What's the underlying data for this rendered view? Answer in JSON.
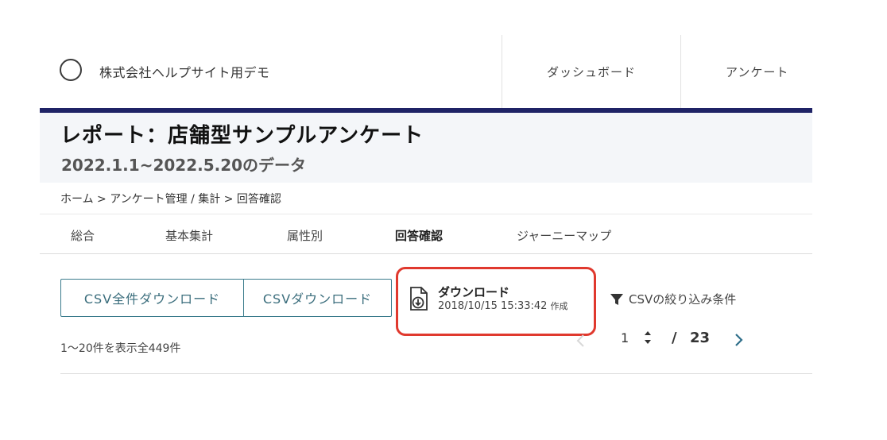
{
  "header": {
    "company_name": "株式会社ヘルプサイト用デモ",
    "nav": {
      "dashboard": "ダッシュボード",
      "survey": "アンケート"
    },
    "accent_color": "#1f2366"
  },
  "report": {
    "title": "レポート：店舗型サンプルアンケート",
    "subtitle": "2022.1.1~2022.5.20のデータ"
  },
  "breadcrumb": "ホーム > アンケート管理 / 集計 > 回答確認",
  "tabs": [
    {
      "label": "総合",
      "active": false
    },
    {
      "label": "基本集計",
      "active": false
    },
    {
      "label": "属性別",
      "active": false
    },
    {
      "label": "回答確認",
      "active": true
    },
    {
      "label": "ジャーニーマップ",
      "active": false
    }
  ],
  "toolbar": {
    "csv_all_download": "CSV全件ダウンロード",
    "csv_download": "CSVダウンロード",
    "download": {
      "title": "ダウンロード",
      "date": "2018/10/15 15:33:42",
      "created_label": "作成",
      "icon": "file-download-icon",
      "highlight_color": "#e0392e"
    },
    "filter_label": "CSVの絞り込み条件",
    "button_color": "#3a7b8c"
  },
  "results": {
    "count_text": "1〜20件を表示全449件"
  },
  "pagination": {
    "current": "1",
    "separator": "/",
    "total": "23"
  }
}
